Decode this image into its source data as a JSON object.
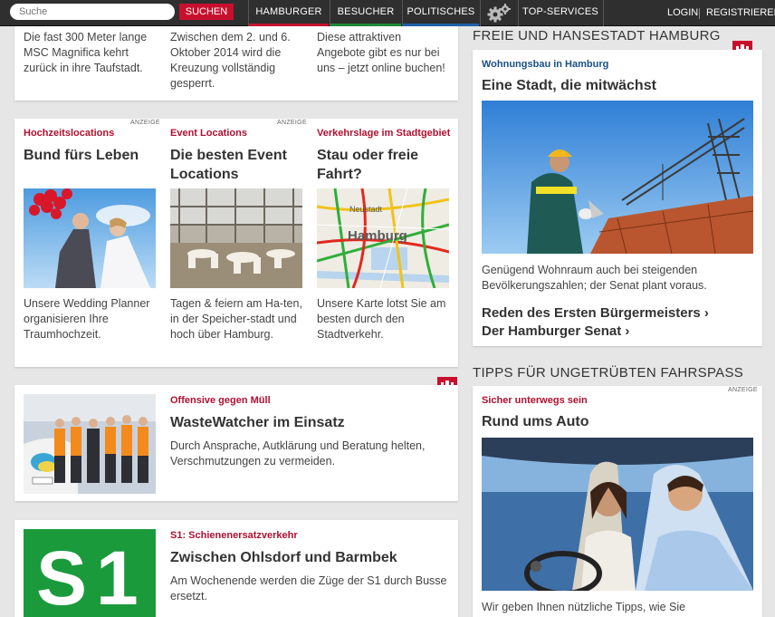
{
  "header": {
    "search_placeholder": "Suche",
    "search_button": "SUCHEN",
    "nav": [
      {
        "label": "HAMBURGER",
        "color": "#c8102e"
      },
      {
        "label": "BESUCHER",
        "color": "#1e8a3c"
      },
      {
        "label": "POLITISCHES",
        "color": "#1f5fa8"
      },
      {
        "label": "TOP-SERVICES",
        "color": ""
      }
    ],
    "login": "LOGIN",
    "register": "REGISTRIEREN"
  },
  "top_row": [
    {
      "body": "Die fast 300 Meter lange MSC Magnifica kehrt zurück in ihre Taufstadt."
    },
    {
      "body": "Zwischen dem 2. und 6. Oktober 2014 wird die Kreuzung vollständig gesperrt."
    },
    {
      "body": "Diese attraktiven Angebote gibt es nur bei uns – jetzt online buchen!"
    }
  ],
  "ads_row": [
    {
      "kicker": "Hochzeitslocations",
      "headline": "Bund fürs Leben",
      "body": "Unsere Wedding Planner organisieren Ihre Traumhochzeit.",
      "badge": "ANZEIGE"
    },
    {
      "kicker": "Event Locations",
      "headline": "Die besten Event Locations",
      "body": "Tagen & feiern am Ha-ten, in der Speicher-stadt und hoch über Hamburg.",
      "badge": "ANZEIGE"
    },
    {
      "kicker": "Verkehrslage im Stadtgebiet",
      "headline": "Stau oder freie Fahrt?",
      "body": "Unsere Karte lotst Sie am besten durch den Stadtverkehr.",
      "map_labels": [
        "Neustadt",
        "Hamburg"
      ]
    }
  ],
  "waste": {
    "kicker": "Offensive gegen Müll",
    "headline": "WasteWatcher im Einsatz",
    "body": "Durch Ansprache, Autklärung und Beratung helten, Verschmutzungen zu vermeiden."
  },
  "s1": {
    "kicker": "S1: Schienenersatzverkehr",
    "headline": "Zwischen Ohlsdorf und Barmbek",
    "body": "Am Wochenende werden die Züge der S1 durch Busse ersetzt.",
    "sign_text": "S1"
  },
  "right": {
    "section1_title": "FREIE UND HANSESTADT HAMBURG",
    "card1": {
      "kicker": "Wohnungsbau in Hamburg",
      "headline": "Eine Stadt, die mitwächst",
      "body": "Genügend Wohnraum auch bei steigenden Bevölkerungszahlen; der Senat plant voraus.",
      "link1": "Reden des Ersten Bürgermeisters ›",
      "link2": "Der Hamburger Senat ›"
    },
    "section2_title": "TIPPS FÜR UNGETRÜBTEN FAHRSPASS",
    "card2": {
      "badge": "ANZEIGE",
      "kicker": "Sicher unterwegs sein",
      "headline": "Rund ums Auto",
      "body": "Wir geben Ihnen nützliche Tipps, wie Sie"
    }
  }
}
